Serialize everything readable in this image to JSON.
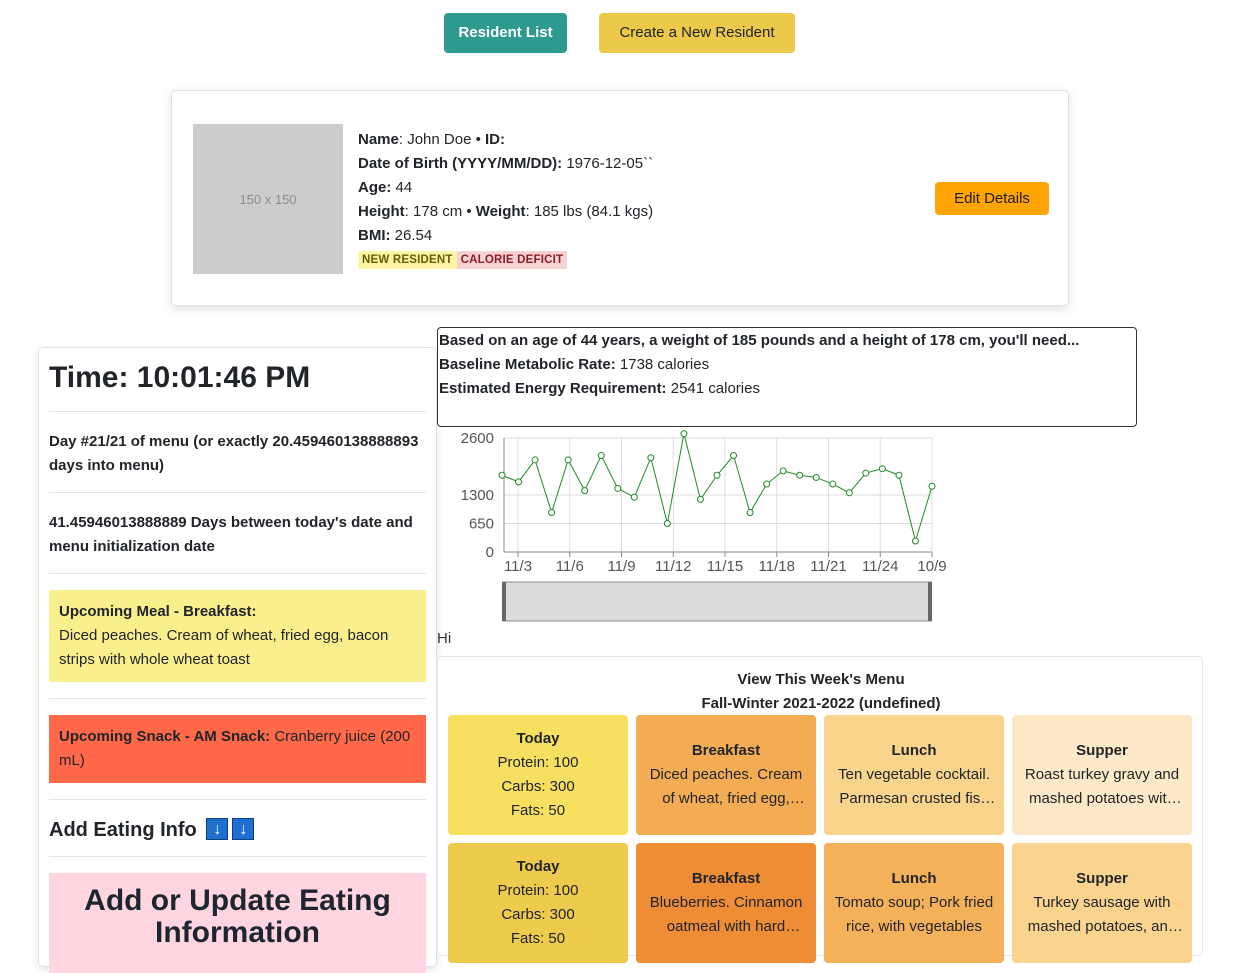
{
  "nav": {
    "resident_list": "Resident List",
    "create_resident": "Create a New Resident"
  },
  "profile": {
    "avatar_text": "150 x 150",
    "name_label": "Name",
    "name_value": ": John Doe",
    "id_label": "ID:",
    "dob_label": "Date of Birth (YYYY/MM/DD):",
    "dob_value": " 1976-12-05``",
    "age_label": "Age:",
    "age_value": " 44",
    "height_label": "Height",
    "height_value": ": 178 cm",
    "weight_label": "Weight",
    "weight_value": ": 185 lbs (84.1 kgs)",
    "bmi_label": "BMI:",
    "bmi_value": " 26.54",
    "badges": [
      "NEW RESIDENT",
      "CALORIE DEFICIT"
    ],
    "edit_button": "Edit Details",
    "badge_colors": {
      "new": "#fdf5a6",
      "deficit": "#f8d1d3"
    }
  },
  "left_panel": {
    "time": "Time: 10:01:46 PM",
    "day_info": "Day #21/21 of menu (or exactly 20.459460138888893 days into menu)",
    "days_between": "41.45946013888889 Days between today's date and menu initialization date",
    "meal_label": "Upcoming Meal - Breakfast:",
    "meal_text": "Diced peaches. Cream of wheat, fried egg, bacon strips with whole wheat toast",
    "snack_label": "Upcoming Snack - AM Snack:",
    "snack_text": " Cranberry juice (200 mL)",
    "add_eating": "Add Eating Info",
    "arrow_glyph": "↓",
    "update_heading": "Add or Update Eating Information"
  },
  "energy": {
    "summary": "Based on an age of 44 years, a weight of 185 pounds and a height of 178 cm, you'll need...",
    "bmr_label": "Baseline Metabolic Rate:",
    "bmr_value": " 1738 calories",
    "eer_label": "Estimated Energy Requirement:",
    "eer_value": " 2541 calories"
  },
  "chart_data": {
    "type": "line",
    "y_ticks": [
      "2600",
      "1300",
      "650",
      "0"
    ],
    "x_ticks": [
      "11/3",
      "11/6",
      "11/9",
      "11/12",
      "11/15",
      "11/18",
      "11/21",
      "11/24",
      "10/9"
    ],
    "values": [
      1750,
      1600,
      2100,
      900,
      2100,
      1400,
      2200,
      1450,
      1250,
      2150,
      650,
      2700,
      1200,
      1750,
      2200,
      900,
      1550,
      1850,
      1750,
      1700,
      1550,
      1350,
      1800,
      1900,
      1750,
      250,
      1500
    ],
    "ylim": [
      0,
      2600
    ],
    "line_color": "#1f8b24",
    "grid": true
  },
  "hi_text": "Hi",
  "menu": {
    "heading_line1": "View This Week's Menu",
    "heading_line2": "Fall-Winter 2021-2022 (undefined)",
    "rows": [
      [
        {
          "title": "Today",
          "lines": [
            "Protein: 100",
            "Carbs: 300",
            "Fats: 50"
          ],
          "color": "#f7df60"
        },
        {
          "title": "Breakfast",
          "body": "Diced peaches. Cream of wheat, fried egg, bacon strips with whole wheat toast",
          "color": "#f4ac54"
        },
        {
          "title": "Lunch",
          "body": "Ten vegetable cocktail. Parmesan crusted fish with rice",
          "color": "#f8d48d"
        },
        {
          "title": "Supper",
          "body": "Roast turkey gravy and mashed potatoes with vegetables",
          "color": "#fde9c8"
        }
      ],
      [
        {
          "title": "Today",
          "lines": [
            "Protein: 100",
            "Carbs: 300",
            "Fats: 50"
          ],
          "color": "#eecb4d"
        },
        {
          "title": "Breakfast",
          "body": "Blueberries. Cinnamon oatmeal with hard boiled egg and toast",
          "color": "#ef8c36"
        },
        {
          "title": "Lunch",
          "body": "Tomato soup; Pork fried rice, with vegetables",
          "color": "#f5b05a"
        },
        {
          "title": "Supper",
          "body": "Turkey sausage with mashed potatoes, and vegetables",
          "color": "#fad48e"
        }
      ]
    ]
  }
}
